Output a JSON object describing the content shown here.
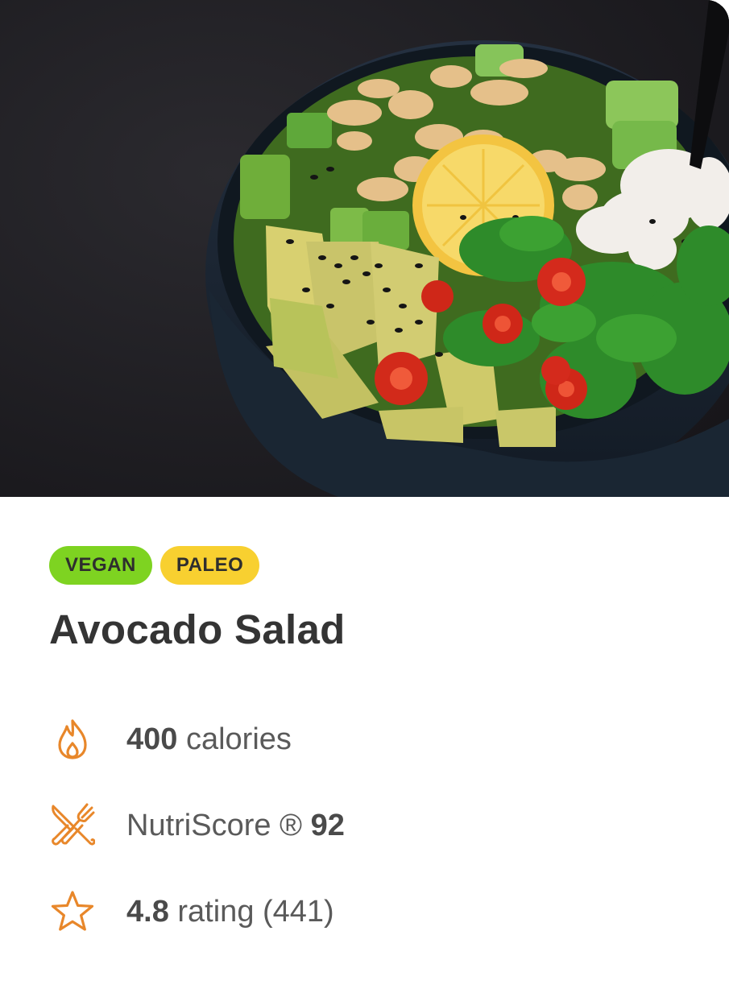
{
  "hero": {
    "image_description_icon": "salad-bowl-photo"
  },
  "tags": [
    {
      "label": "VEGAN",
      "color": "#7ed321"
    },
    {
      "label": "PALEO",
      "color": "#f8d030"
    }
  ],
  "title": "Avocado Salad",
  "stats": {
    "calories": {
      "icon": "flame-icon",
      "value": "400",
      "unit": "calories"
    },
    "nutriscore": {
      "icon": "fork-knife-icon",
      "label": "NutriScore ®",
      "value": "92"
    },
    "rating": {
      "icon": "star-icon",
      "value": "4.8",
      "label": "rating (441)"
    }
  },
  "accent_color": "#e8872a"
}
